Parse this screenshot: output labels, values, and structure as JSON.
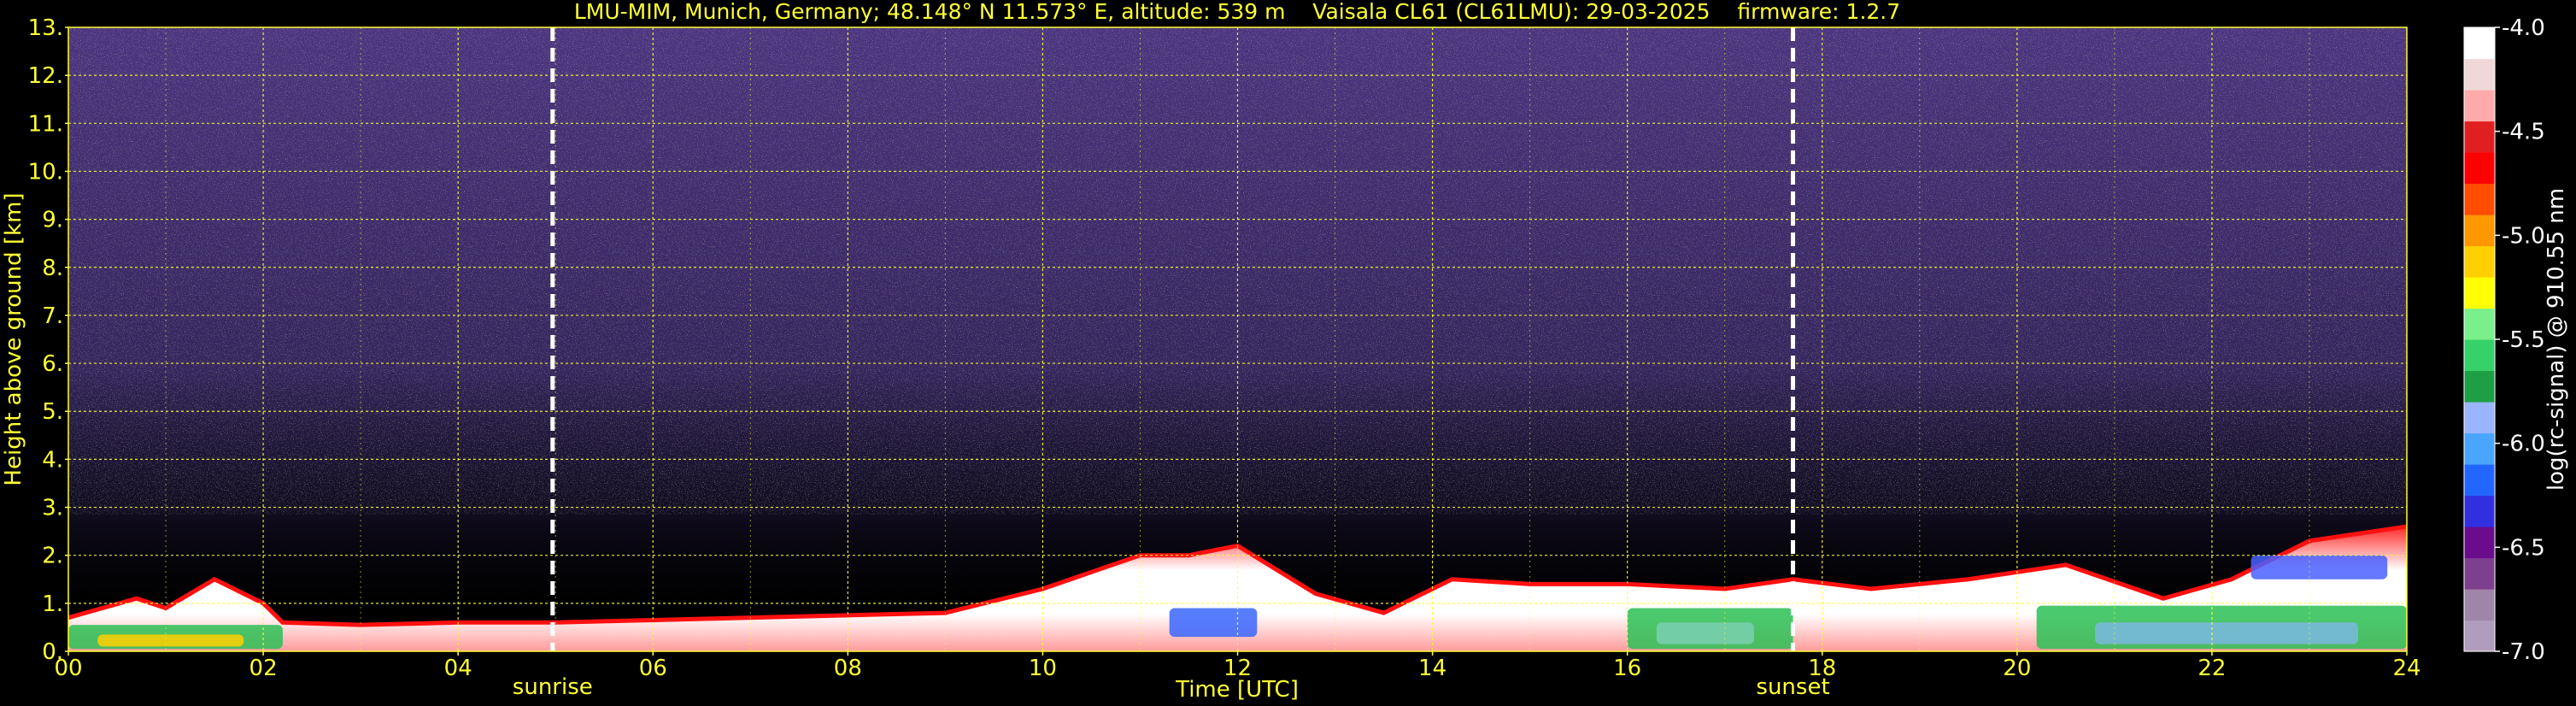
{
  "chart_data": {
    "type": "heatmap",
    "title": "LMU-MIM, Munich, Germany; 48.148° N 11.573° E, altitude: 539 m    Vaisala CL61 (CL61LMU): 29-03-2025    firmware: 1.2.7",
    "xlabel": "Time [UTC]",
    "ylabel": "Height above ground [km]",
    "xlim": [
      0,
      24
    ],
    "ylim": [
      0,
      13
    ],
    "x_ticks": [
      "00",
      "02",
      "04",
      "06",
      "08",
      "10",
      "12",
      "14",
      "16",
      "18",
      "20",
      "22",
      "24"
    ],
    "x_tick_values": [
      0,
      2,
      4,
      6,
      8,
      10,
      12,
      14,
      16,
      18,
      20,
      22,
      24
    ],
    "y_ticks": [
      "0.",
      "1.",
      "2.",
      "3.",
      "4.",
      "5.",
      "6.",
      "7.",
      "8.",
      "9.",
      "10.",
      "11.",
      "12.",
      "13."
    ],
    "y_tick_values": [
      0,
      1,
      2,
      3,
      4,
      5,
      6,
      7,
      8,
      9,
      10,
      11,
      12,
      13
    ],
    "grid": true,
    "grid_color": "#ffff33",
    "sunrise": {
      "label": "sunrise",
      "time": 4.97
    },
    "sunset": {
      "label": "sunset",
      "time": 17.7
    },
    "boundary_layer_top": [
      {
        "t": 0.0,
        "h": 0.7
      },
      {
        "t": 0.7,
        "h": 1.1
      },
      {
        "t": 1.0,
        "h": 0.9
      },
      {
        "t": 1.5,
        "h": 1.5
      },
      {
        "t": 2.0,
        "h": 1.0
      },
      {
        "t": 2.2,
        "h": 0.6
      },
      {
        "t": 3.0,
        "h": 0.55
      },
      {
        "t": 4.0,
        "h": 0.6
      },
      {
        "t": 5.0,
        "h": 0.6
      },
      {
        "t": 6.0,
        "h": 0.65
      },
      {
        "t": 8.0,
        "h": 0.75
      },
      {
        "t": 9.0,
        "h": 0.8
      },
      {
        "t": 10.0,
        "h": 1.3
      },
      {
        "t": 11.0,
        "h": 2.0
      },
      {
        "t": 11.5,
        "h": 2.0
      },
      {
        "t": 12.0,
        "h": 2.2
      },
      {
        "t": 12.8,
        "h": 1.2
      },
      {
        "t": 13.5,
        "h": 0.8
      },
      {
        "t": 14.2,
        "h": 1.5
      },
      {
        "t": 15.0,
        "h": 1.4
      },
      {
        "t": 16.0,
        "h": 1.4
      },
      {
        "t": 17.0,
        "h": 1.3
      },
      {
        "t": 17.7,
        "h": 1.5
      },
      {
        "t": 18.5,
        "h": 1.3
      },
      {
        "t": 19.5,
        "h": 1.5
      },
      {
        "t": 20.5,
        "h": 1.8
      },
      {
        "t": 21.5,
        "h": 1.1
      },
      {
        "t": 22.2,
        "h": 1.5
      },
      {
        "t": 23.0,
        "h": 2.3
      },
      {
        "t": 24.0,
        "h": 2.6
      }
    ],
    "colorbar": {
      "label": "log(rc-signal) @ 910.55 nm",
      "ticks": [
        "-4.0",
        "-4.5",
        "-5.0",
        "-5.5",
        "-6.0",
        "-6.5",
        "-7.0"
      ],
      "range": [
        -7.0,
        -4.0
      ],
      "colors": [
        "#b09cbc",
        "#9f86a8",
        "#7d3f8e",
        "#6a0c8c",
        "#3030e0",
        "#2266ff",
        "#4aa5ff",
        "#9ab5ff",
        "#1f9f44",
        "#36d169",
        "#7af08a",
        "#ffff00",
        "#ffd000",
        "#ff9800",
        "#ff4d00",
        "#ff0000",
        "#e02020",
        "#ffaaaa",
        "#f0d8d8",
        "#ffffff"
      ]
    }
  }
}
